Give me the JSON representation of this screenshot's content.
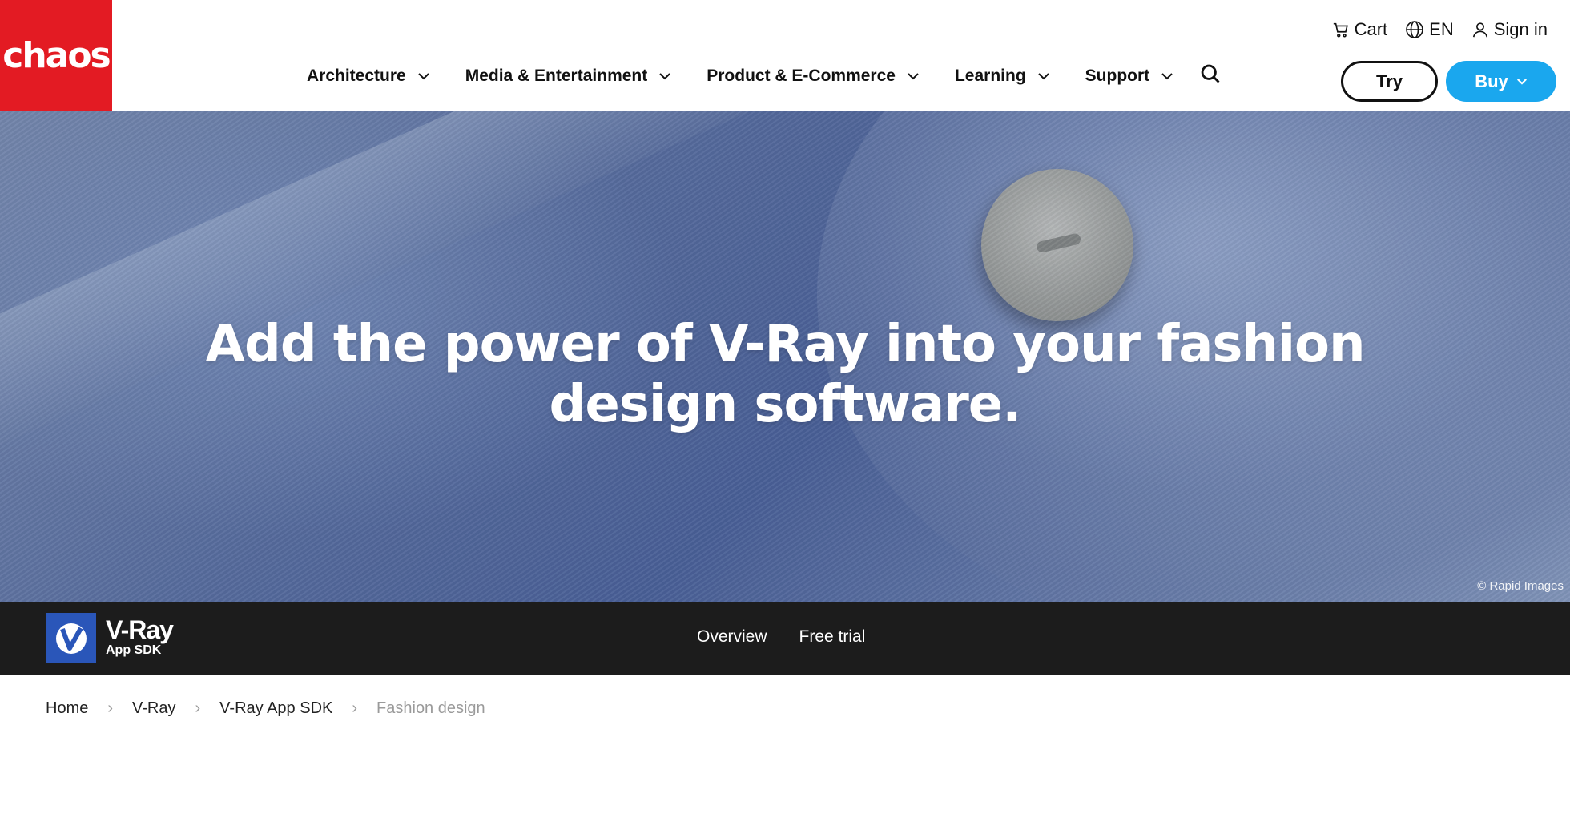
{
  "brand": {
    "logo_text": "chaos",
    "logo_color": "#e31b23"
  },
  "utility": {
    "cart": "Cart",
    "language": "EN",
    "signin": "Sign in"
  },
  "nav": {
    "items": [
      {
        "label": "Architecture"
      },
      {
        "label": "Media & Entertainment"
      },
      {
        "label": "Product & E-Commerce"
      },
      {
        "label": "Learning"
      },
      {
        "label": "Support"
      }
    ]
  },
  "actions": {
    "try": "Try",
    "buy": "Buy",
    "buy_color": "#1aa7ee"
  },
  "hero": {
    "headline": "Add the power of V-Ray into your fashion design software.",
    "credit": "© Rapid Images"
  },
  "product": {
    "name": "V-Ray",
    "subtitle": "App SDK",
    "links": [
      "Overview",
      "Free trial"
    ]
  },
  "breadcrumb": [
    "Home",
    "V-Ray",
    "V-Ray App SDK",
    "Fashion design"
  ]
}
